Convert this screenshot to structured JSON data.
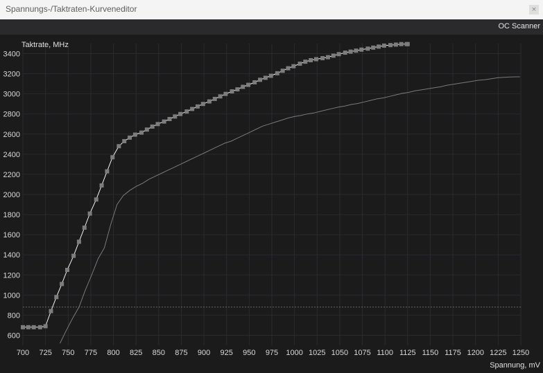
{
  "window": {
    "title": "Spannungs-/Taktraten-Kurveneditor",
    "close_glyph": "×"
  },
  "toolbar": {
    "oc_scanner_label": "OC Scanner"
  },
  "colors": {
    "background": "#1b1b1c",
    "grid": "#2b2b2e",
    "curve": "#f2f2f2",
    "points": "#7d7d7d",
    "reference_curve": "#7a7a7a",
    "threshold_line": "#6a6a6a"
  },
  "chart_data": {
    "type": "line",
    "xlabel": "Spannung, mV",
    "ylabel": "Taktrate, MHz",
    "xlim": [
      700,
      1250
    ],
    "ylim": [
      500,
      3500
    ],
    "x_ticks": [
      700,
      725,
      750,
      775,
      800,
      825,
      850,
      875,
      900,
      925,
      950,
      975,
      1000,
      1025,
      1050,
      1075,
      1100,
      1125,
      1150,
      1175,
      1200,
      1225,
      1250
    ],
    "y_ticks": [
      600,
      800,
      1000,
      1200,
      1400,
      1600,
      1800,
      2000,
      2200,
      2400,
      2600,
      2800,
      3000,
      3200,
      3400
    ],
    "grid": true,
    "threshold_y": 880,
    "series": [
      {
        "role": "edited-curve",
        "markers": true,
        "x": [
          700,
          706,
          712,
          719,
          725,
          731,
          737,
          743,
          749,
          756,
          762,
          768,
          774,
          781,
          787,
          793,
          799,
          806,
          812,
          818,
          824,
          831,
          837,
          843,
          849,
          856,
          862,
          868,
          874,
          881,
          887,
          893,
          899,
          906,
          912,
          918,
          924,
          931,
          937,
          943,
          949,
          956,
          962,
          968,
          974,
          981,
          987,
          993,
          999,
          1006,
          1012,
          1018,
          1024,
          1031,
          1037,
          1043,
          1049,
          1056,
          1062,
          1068,
          1074,
          1081,
          1087,
          1093,
          1099,
          1106,
          1112,
          1118,
          1124,
          1125
        ],
        "y": [
          680,
          680,
          680,
          680,
          690,
          840,
          980,
          1110,
          1250,
          1390,
          1530,
          1670,
          1810,
          1950,
          2090,
          2230,
          2370,
          2480,
          2530,
          2565,
          2595,
          2615,
          2645,
          2675,
          2700,
          2725,
          2750,
          2775,
          2800,
          2825,
          2850,
          2875,
          2900,
          2925,
          2950,
          2975,
          3000,
          3025,
          3045,
          3070,
          3090,
          3115,
          3140,
          3160,
          3180,
          3205,
          3230,
          3255,
          3275,
          3300,
          3320,
          3335,
          3345,
          3355,
          3365,
          3380,
          3395,
          3410,
          3420,
          3430,
          3440,
          3450,
          3460,
          3470,
          3480,
          3485,
          3490,
          3495,
          3495,
          3495
        ]
      },
      {
        "role": "reference-curve",
        "markers": false,
        "x": [
          741,
          748,
          755,
          762,
          769,
          776,
          783,
          790,
          797,
          804,
          811,
          818,
          825,
          832,
          839,
          846,
          853,
          860,
          867,
          874,
          881,
          888,
          895,
          902,
          909,
          916,
          923,
          930,
          937,
          944,
          951,
          958,
          965,
          972,
          979,
          986,
          993,
          1000,
          1007,
          1014,
          1021,
          1028,
          1035,
          1042,
          1049,
          1056,
          1063,
          1070,
          1077,
          1084,
          1091,
          1098,
          1105,
          1112,
          1119,
          1126,
          1133,
          1140,
          1147,
          1154,
          1161,
          1168,
          1175,
          1182,
          1189,
          1196,
          1203,
          1210,
          1217,
          1224,
          1231,
          1238,
          1245,
          1249
        ],
        "y": [
          520,
          650,
          770,
          880,
          1050,
          1200,
          1360,
          1470,
          1700,
          1900,
          1990,
          2040,
          2080,
          2110,
          2150,
          2180,
          2210,
          2240,
          2270,
          2300,
          2330,
          2360,
          2390,
          2420,
          2450,
          2480,
          2510,
          2530,
          2560,
          2590,
          2620,
          2650,
          2680,
          2700,
          2720,
          2740,
          2760,
          2775,
          2785,
          2800,
          2810,
          2825,
          2840,
          2855,
          2870,
          2880,
          2895,
          2905,
          2920,
          2935,
          2950,
          2960,
          2975,
          2990,
          3005,
          3015,
          3030,
          3040,
          3050,
          3060,
          3070,
          3085,
          3095,
          3105,
          3115,
          3125,
          3135,
          3140,
          3150,
          3160,
          3165,
          3168,
          3170,
          3170
        ]
      }
    ]
  }
}
